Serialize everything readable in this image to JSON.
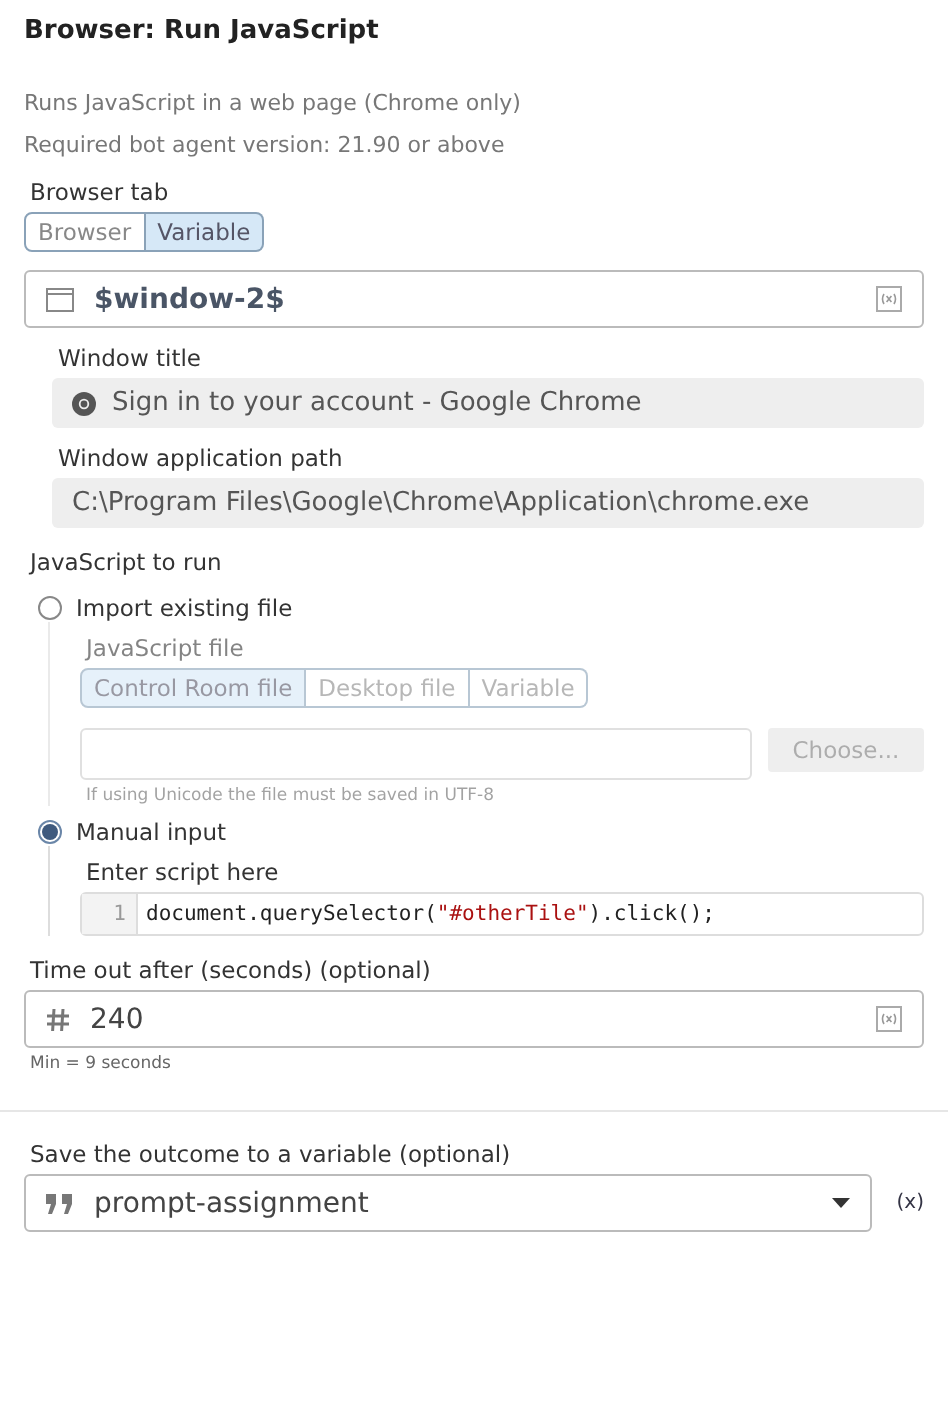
{
  "title": "Browser: Run JavaScript",
  "description": [
    "Runs JavaScript in a web page (Chrome only)",
    "Required bot agent version: 21.90 or above"
  ],
  "browser_tab": {
    "label": "Browser tab",
    "options": [
      {
        "label": "Browser",
        "selected": false
      },
      {
        "label": "Variable",
        "selected": true
      }
    ],
    "value": "$window-2$"
  },
  "window_title": {
    "label": "Window title",
    "value": "Sign in to your account - Google Chrome"
  },
  "window_path": {
    "label": "Window application path",
    "value": "C:\\Program Files\\Google\\Chrome\\Application\\chrome.exe"
  },
  "script_section": {
    "label": "JavaScript to run",
    "options": [
      {
        "label": "Import existing file",
        "selected": false,
        "kind": "file",
        "field_label": "JavaScript file",
        "sources": [
          {
            "label": "Control Room file",
            "selected": true
          },
          {
            "label": "Desktop file",
            "selected": false
          },
          {
            "label": "Variable",
            "selected": false
          }
        ],
        "button": "Choose...",
        "hint": "If using Unicode the file must be saved in UTF-8",
        "disabled": true
      },
      {
        "label": "Manual input",
        "selected": true,
        "kind": "manual",
        "field_label": "Enter script here",
        "line_number": "1",
        "code": [
          {
            "text": "document.querySelector(",
            "kind": "plain"
          },
          {
            "text": "\"#otherTile\"",
            "kind": "string"
          },
          {
            "text": ").click();",
            "kind": "plain"
          }
        ]
      }
    ]
  },
  "timeout": {
    "label": "Time out after (seconds) (optional)",
    "value": "240",
    "hint": "Min = 9 seconds"
  },
  "output": {
    "label": "Save the outcome to a variable (optional)",
    "value": "prompt-assignment",
    "insert_variable": "(x)"
  }
}
